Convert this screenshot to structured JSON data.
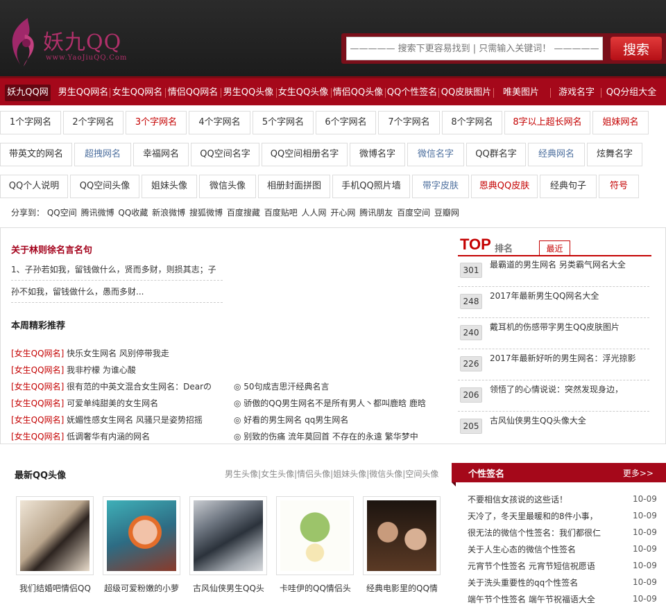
{
  "header": {
    "logo_text": "妖九QQ",
    "logo_url": "www.YaoJiuQQ.Com",
    "search_placeholder": "————— 搜索下更容易找到 | 只需输入关键词！ —————",
    "search_button": "搜索"
  },
  "nav": [
    {
      "label": "妖九QQ网",
      "active": true
    },
    {
      "label": "男生QQ网名"
    },
    {
      "label": "女生QQ网名"
    },
    {
      "label": "情侣QQ网名"
    },
    {
      "label": "男生QQ头像"
    },
    {
      "label": "女生QQ头像"
    },
    {
      "label": "情侣QQ头像"
    },
    {
      "label": "QQ个性签名"
    },
    {
      "label": "QQ皮肤图片"
    },
    {
      "label": "唯美图片"
    },
    {
      "label": "游戏名字"
    },
    {
      "label": "QQ分组大全"
    }
  ],
  "tags": {
    "row1": [
      {
        "label": "1个字网名"
      },
      {
        "label": "2个字网名"
      },
      {
        "label": "3个字网名",
        "style": "red"
      },
      {
        "label": "4个字网名"
      },
      {
        "label": "5个字网名"
      },
      {
        "label": "6个字网名"
      },
      {
        "label": "7个字网名"
      },
      {
        "label": "8个字网名"
      },
      {
        "label": "8字以上超长网名",
        "style": "red"
      },
      {
        "label": "姐妹网名",
        "style": "red"
      }
    ],
    "row2": [
      {
        "label": "带英文的网名"
      },
      {
        "label": "超拽网名",
        "style": "blue"
      },
      {
        "label": "幸福网名"
      },
      {
        "label": "QQ空间名字"
      },
      {
        "label": "QQ空间相册名字"
      },
      {
        "label": "微博名字"
      },
      {
        "label": "微信名字",
        "style": "blue"
      },
      {
        "label": "QQ群名字"
      },
      {
        "label": "经典网名",
        "style": "blue"
      },
      {
        "label": "炫舞名字"
      }
    ],
    "row3": [
      {
        "label": "QQ个人说明"
      },
      {
        "label": "QQ空间头像"
      },
      {
        "label": "姐妹头像"
      },
      {
        "label": "微信头像"
      },
      {
        "label": "相册封面拼图"
      },
      {
        "label": "手机QQ照片墙"
      },
      {
        "label": "带字皮肤",
        "style": "blue"
      },
      {
        "label": "恩典QQ皮肤",
        "style": "red"
      },
      {
        "label": "经典句子"
      },
      {
        "label": "符号",
        "style": "red"
      }
    ]
  },
  "share": {
    "label": "分享到：",
    "items": [
      "QQ空间",
      "腾讯微博",
      "QQ收藏",
      "新浪微博",
      "搜狐微博",
      "百度搜藏",
      "百度贴吧",
      "人人网",
      "开心网",
      "腾讯朋友",
      "百度空间",
      "豆瓣网"
    ]
  },
  "article": {
    "title": "关于林则徐名言名句",
    "lines": [
      "1、子孙若如我，留钱做什么，贤而多财，则损其志；子",
      "孙不如我，留钱做什么，愚而多财..."
    ]
  },
  "weekly": {
    "title": "本周精彩推荐",
    "left": [
      {
        "cat": "[女生QQ网名]",
        "text": "快乐女生网名 风别停带我走"
      },
      {
        "cat": "[女生QQ网名]",
        "text": "我非柠檬 为谁心酸"
      },
      {
        "cat": "[女生QQ网名]",
        "text": "很有范的中英文混合女生网名：Dearの"
      },
      {
        "cat": "[女生QQ网名]",
        "text": "可爱单纯甜美的女生网名"
      },
      {
        "cat": "[女生QQ网名]",
        "text": "妩媚性感女生网名 风骚只是姿势招摇"
      },
      {
        "cat": "[女生QQ网名]",
        "text": "低调奢华有内涵的网名"
      }
    ],
    "right": [
      "◎ 50句成吉思汗经典名言",
      "◎ 骄傲的QQ男生网名不是所有男人丶都叫鹿晗 鹿晗",
      "◎ 好看的男生网名 qq男生网名",
      "◎ 别致的伤痛 流年莫回首 不存在的永遠 繁华梦中"
    ]
  },
  "top": {
    "logo": "TOP",
    "rank_label": "排名",
    "tab": "最近",
    "items": [
      {
        "num": "301",
        "text": "最霸道的男生网名 另类霸气网名大全"
      },
      {
        "num": "248",
        "text": "2017年最新男生QQ网名大全"
      },
      {
        "num": "240",
        "text": "戴耳机的伤感带字男生QQ皮肤图片"
      },
      {
        "num": "226",
        "text": "2017年最新好听的男生网名：浮光掠影"
      },
      {
        "num": "206",
        "text": "领悟了的心情说说：突然发现身边，"
      },
      {
        "num": "205",
        "text": "古风仙侠男生QQ头像大全"
      }
    ]
  },
  "avatars": {
    "title": "最新QQ头像",
    "links": [
      "男生头像",
      "女生头像",
      "情侣头像",
      "姐妹头像",
      "微信头像",
      "空间头像"
    ],
    "items": [
      {
        "caption": "我们结婚吧情侣QQ"
      },
      {
        "caption": "超级可爱粉嫩的小萝"
      },
      {
        "caption": "古风仙侠男生QQ头"
      },
      {
        "caption": "卡哇伊的QQ情侣头"
      },
      {
        "caption": "经典电影里的QQ情"
      }
    ]
  },
  "signatures": {
    "title": "个性签名",
    "more": "更多>>",
    "items": [
      {
        "text": "不要相信女孩说的这些话！",
        "date": "10-09"
      },
      {
        "text": "天冷了，冬天里最暖和的8件小事，",
        "date": "10-09"
      },
      {
        "text": "很无法的微信个性签名：我们都很仁",
        "date": "10-09"
      },
      {
        "text": "关于人生心态的微信个性签名",
        "date": "10-09"
      },
      {
        "text": "元宵节个性签名 元宵节短信祝愿语",
        "date": "10-09"
      },
      {
        "text": "关于洗头重要性的qq个性签名",
        "date": "10-09"
      },
      {
        "text": "端午节个性签名 端午节祝福语大全",
        "date": "10-09"
      }
    ]
  },
  "colors": {
    "brand_red": "#a5081a",
    "accent_pink": "#b0306a",
    "header_bg": "#222222"
  }
}
